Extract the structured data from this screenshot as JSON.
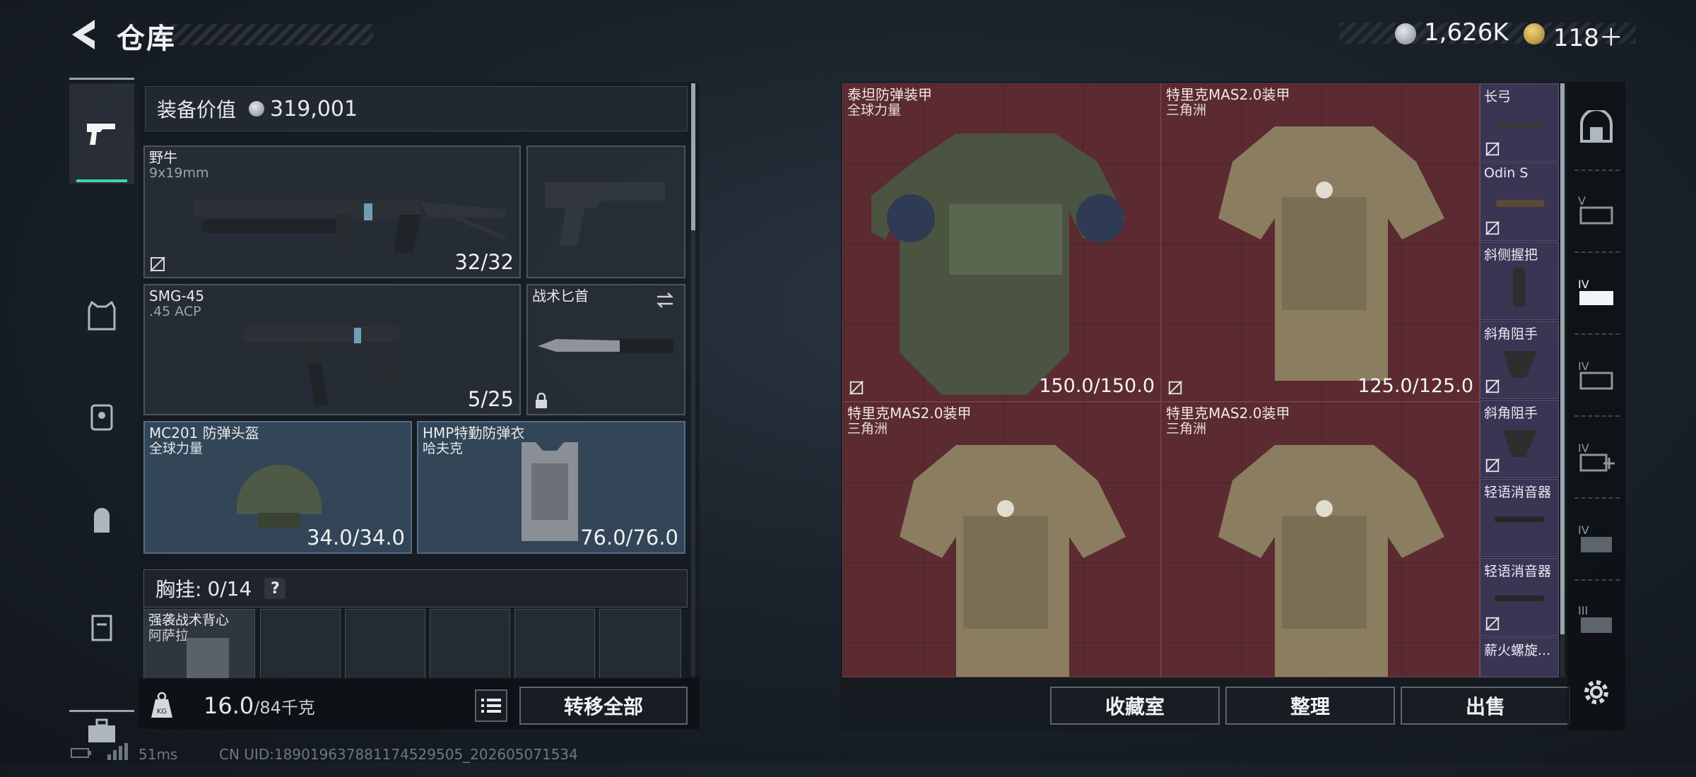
{
  "header": {
    "title": "仓库"
  },
  "currency": [
    {
      "icon": "silver-coin-icon",
      "value": "1,626K"
    },
    {
      "icon": "gold-coin-icon",
      "value": "118＋"
    }
  ],
  "equipment": {
    "value_label": "装备价值",
    "value": "319,001",
    "primary_weapon": {
      "name": "野牛",
      "ammo": "9x19mm",
      "count": "32/32"
    },
    "secondary_weapon": {
      "name": "SMG-45",
      "ammo": ".45 ACP",
      "count": "5/25"
    },
    "melee": {
      "name": "战术匕首"
    },
    "helmet": {
      "name": "MC201 防弹头盔",
      "brand": "全球力量",
      "durability": "34.0/34.0"
    },
    "armor": {
      "name": "HMP特勤防弹衣",
      "brand": "哈夫克",
      "durability": "76.0/76.0"
    },
    "chest_rig": {
      "label": "胸挂:",
      "count": "0/14",
      "help": "?"
    },
    "backpack_item": {
      "name": "强袭战术背心",
      "brand": "阿萨拉"
    },
    "weight": {
      "current": "16.0",
      "max": "/84千克"
    },
    "transfer_all": "转移全部"
  },
  "storage": {
    "armors": [
      {
        "name": "泰坦防弹装甲",
        "brand": "全球力量",
        "durability": "150.0/150.0"
      },
      {
        "name": "特里克MAS2.0装甲",
        "brand": "三角洲",
        "durability": "125.0/125.0"
      },
      {
        "name": "特里克MAS2.0装甲",
        "brand": "三角洲"
      },
      {
        "name": "特里克MAS2.0装甲",
        "brand": "三角洲"
      }
    ],
    "small_items": [
      {
        "name": "长弓"
      },
      {
        "name": "Odin S"
      },
      {
        "name": "斜侧握把"
      },
      {
        "name": "斜角阻手"
      },
      {
        "name": "斜角阻手"
      },
      {
        "name": "轻语消音器"
      },
      {
        "name": "轻语消音器"
      },
      {
        "name": "薪火螺旋..."
      }
    ],
    "buttons": {
      "collection": "收藏室",
      "sort": "整理",
      "sell": "出售"
    }
  },
  "right_nav": [
    "armory-icon",
    "tier-v-box-icon",
    "tier-iv-crate-icon",
    "tier-iv-box-icon",
    "tier-iv-medical-icon",
    "tier-iv-folder-icon",
    "tier-iii-box-icon"
  ],
  "footer": {
    "ping": "51ms",
    "uid": "CN UID:1890196378811745295​05_202605071534"
  }
}
